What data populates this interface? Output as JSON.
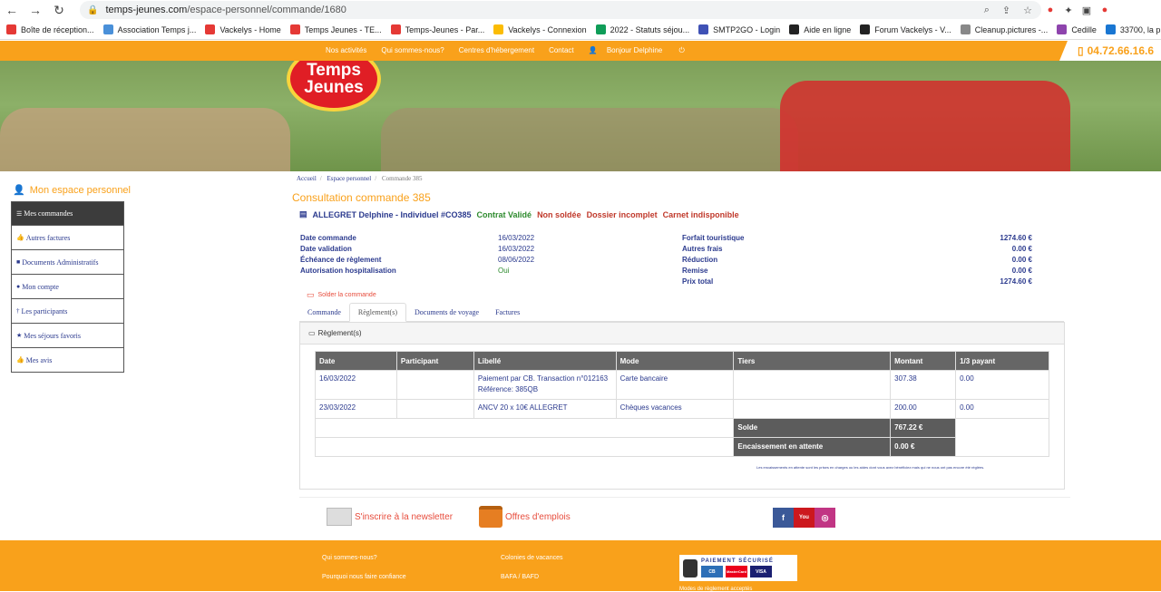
{
  "browser": {
    "url_host": "temps-jeunes.com",
    "url_path": "/espace-personnel/commande/1680",
    "bookmarks": [
      {
        "label": "Boîte de réception...",
        "color": "#e53935"
      },
      {
        "label": "Association Temps j...",
        "color": "#4a90d9"
      },
      {
        "label": "Vackelys - Home",
        "color": "#e53935"
      },
      {
        "label": "Temps Jeunes - TE...",
        "color": "#e53935"
      },
      {
        "label": "Temps-Jeunes - Par...",
        "color": "#e53935"
      },
      {
        "label": "Vackelys - Connexion",
        "color": "#fbbc04"
      },
      {
        "label": "2022 - Statuts séjou...",
        "color": "#0f9d58"
      },
      {
        "label": "SMTP2GO - Login",
        "color": "#3f51b5"
      },
      {
        "label": "Aide en ligne",
        "color": "#222222"
      },
      {
        "label": "Forum Vackelys - V...",
        "color": "#222222"
      },
      {
        "label": "Cleanup.pictures -...",
        "color": "#888888"
      },
      {
        "label": "Cedille",
        "color": "#8e44ad"
      },
      {
        "label": "33700, la plateform...",
        "color": "#1976d2"
      }
    ]
  },
  "site": {
    "menu": [
      "Nos activités",
      "Qui sommes-nous?",
      "Centres d'hébergement",
      "Contact",
      "Bonjour Delphine"
    ],
    "phone": "04.72.66.16.6",
    "logo_line1": "Temps",
    "logo_line2": "Jeunes"
  },
  "sidebar": {
    "title": "Mon espace personnel",
    "items": [
      {
        "label": "Mes commandes",
        "icon": "list-icon"
      },
      {
        "label": "Autres factures",
        "icon": "thumb-icon"
      },
      {
        "label": "Documents Administratifs",
        "icon": "folder-icon"
      },
      {
        "label": "Mon compte",
        "icon": "user-icon"
      },
      {
        "label": "Les participants",
        "icon": "person-icon"
      },
      {
        "label": "Mes séjours favoris",
        "icon": "star-icon"
      },
      {
        "label": "Mes avis",
        "icon": "thumb-icon"
      }
    ]
  },
  "breadcrumb": [
    "Accueil",
    "Espace personnel",
    "Commande 385"
  ],
  "page_title": "Consultation commande 385",
  "client": {
    "name": "ALLEGRET Delphine - Individuel #CO385",
    "status_ok": "Contrat Validé",
    "status_ko": [
      "Non soldée",
      "Dossier incomplet",
      "Carnet indisponible"
    ]
  },
  "info_left": [
    {
      "label": "Date commande",
      "value": "16/03/2022"
    },
    {
      "label": "Date validation",
      "value": "16/03/2022"
    },
    {
      "label": "Échéance de règlement",
      "value": "08/06/2022"
    },
    {
      "label": "Autorisation hospitalisation",
      "value": "Oui"
    }
  ],
  "info_right": [
    {
      "label": "Forfait touristique",
      "value": "1274.60 €"
    },
    {
      "label": "Autres frais",
      "value": "0.00 €"
    },
    {
      "label": "Réduction",
      "value": "0.00 €"
    },
    {
      "label": "Remise",
      "value": "0.00 €"
    },
    {
      "label": "Prix total",
      "value": "1274.60 €"
    }
  ],
  "solder_label": "Solder la commande",
  "tabs": [
    "Commande",
    "Règlement(s)",
    "Documents de voyage",
    "Factures"
  ],
  "reglements": {
    "header": "Règlement(s)",
    "columns": [
      "Date",
      "Participant",
      "Libellé",
      "Mode",
      "Tiers",
      "Montant",
      "1/3 payant"
    ],
    "rows": [
      [
        "16/03/2022",
        "",
        "Paiement par CB. Transaction n°012163 Référence: 385QB",
        "Carte bancaire",
        "",
        "307.38",
        "0.00"
      ],
      [
        "23/03/2022",
        "",
        "ANCV 20 x 10€ ALLEGRET",
        "Chèques vacances",
        "",
        "200.00",
        "0.00"
      ]
    ],
    "solde_label": "Solde",
    "solde_value": "767.22 €",
    "attente_label": "Encaissement en attente",
    "attente_value": "0.00 €",
    "note": "Les encaissements en attente sont les prises en charges ou les aides dont vous avez bénéficiez mais qui ne nous ont pas encore été réglées."
  },
  "footer_top": {
    "newsletter": "S'inscrire à la newsletter",
    "jobs": "Offres d'emplois",
    "social": [
      {
        "label": "f",
        "color": "#3b5998"
      },
      {
        "label": "You",
        "color": "#cc181e"
      },
      {
        "label": "◎",
        "color": "#c13584"
      }
    ]
  },
  "footer": {
    "col1": [
      "Qui sommes-nous?",
      "Pourquoi nous faire confiance"
    ],
    "col2": [
      "Colonies de vacances",
      "BAFA / BAFD"
    ],
    "payment_title": "PAIEMENT SÉCURISÉ",
    "payment_cards": [
      {
        "label": "CB",
        "color": "#2d6fb7"
      },
      {
        "label": "MasterCard",
        "color": "#eb001b"
      },
      {
        "label": "VISA",
        "color": "#1a1f71"
      }
    ],
    "modes": "Modes de règlement acceptés"
  }
}
